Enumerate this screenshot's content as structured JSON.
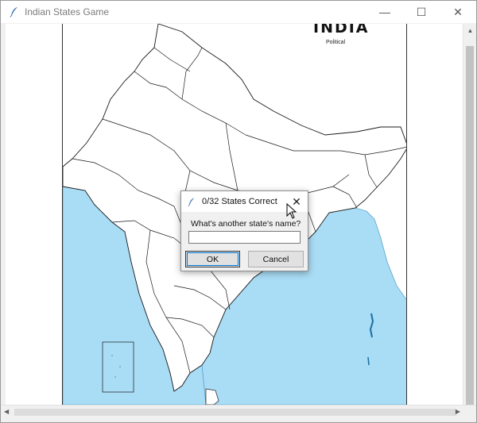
{
  "window": {
    "title": "Indian States Game",
    "minimize_glyph": "—",
    "maximize_glyph": "☐",
    "close_glyph": "✕",
    "icon": "feather-icon"
  },
  "map": {
    "title": "INDIA",
    "subtitle": "Political",
    "sea_color": "#a9dcf5",
    "land_color": "#ffffff",
    "border_color": "#1a1a1a"
  },
  "dialog": {
    "title": "0/32 States Correct",
    "prompt": "What's another state's name?",
    "input_value": "",
    "ok_label": "OK",
    "cancel_label": "Cancel",
    "close_glyph": "✕",
    "icon": "feather-icon"
  },
  "scrollbars": {
    "up_glyph": "▲",
    "down_glyph": "▼",
    "left_glyph": "◀",
    "right_glyph": "▶"
  }
}
